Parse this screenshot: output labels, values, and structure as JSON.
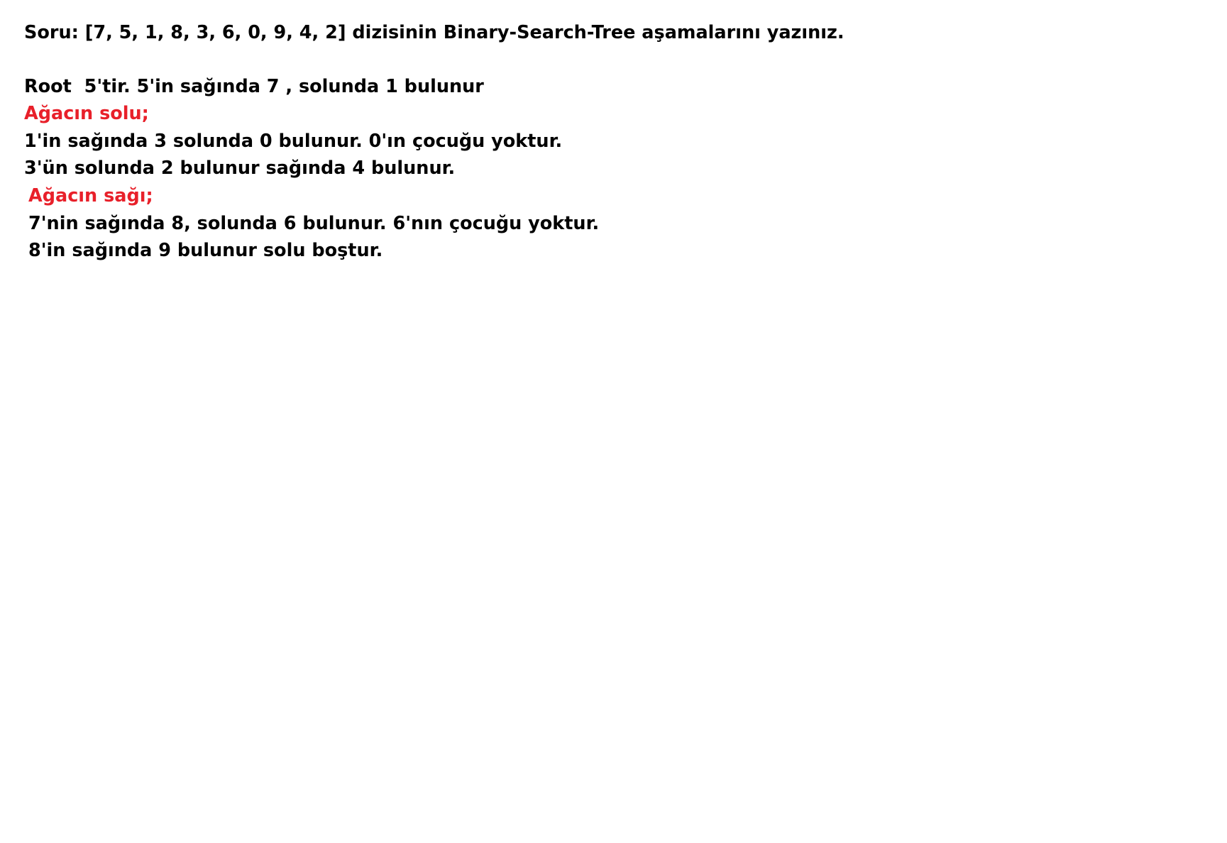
{
  "document": {
    "question": "Soru: [7, 5, 1, 8, 3, 6, 0, 9, 4, 2] dizisinin Binary-Search-Tree aşamalarını yazınız.",
    "root_line": "Root  5'tir. 5'in sağında 7 , solunda 1 bulunur",
    "left_heading": "Ağacın solu;",
    "left_lines": [
      "1'in sağında 3 solunda 0 bulunur. 0'ın çocuğu yoktur.",
      "3'ün solunda 2 bulunur sağında 4 bulunur."
    ],
    "right_heading": "Ağacın sağı;",
    "right_lines": [
      "7'nin sağında 8, solunda 6 bulunur. 6'nın çocuğu yoktur.",
      "8'in sağında 9 bulunur solu boştur."
    ]
  },
  "colors": {
    "text": "#000000",
    "heading_accent": "#e8202a",
    "background": "#ffffff"
  }
}
